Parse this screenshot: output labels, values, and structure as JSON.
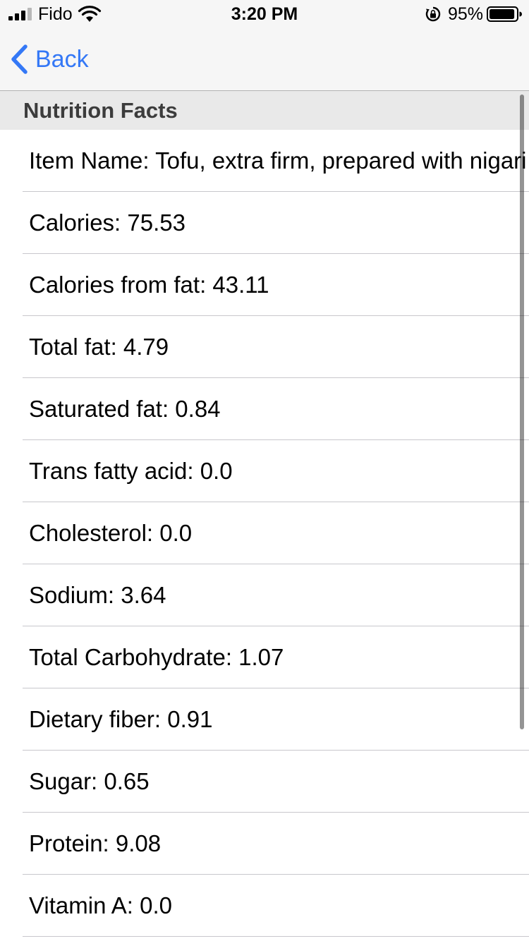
{
  "status_bar": {
    "carrier": "Fido",
    "time": "3:20 PM",
    "battery_percent": "95%",
    "battery_level": 0.95
  },
  "nav": {
    "back_label": "Back"
  },
  "section": {
    "title": "Nutrition Facts"
  },
  "rows": [
    "Item Name: Tofu, extra firm, prepared with nigari",
    "Calories: 75.53",
    "Calories from fat: 43.11",
    "Total fat: 4.79",
    "Saturated fat: 0.84",
    "Trans fatty acid: 0.0",
    "Cholesterol: 0.0",
    "Sodium: 3.64",
    "Total Carbohydrate: 1.07",
    "Dietary fiber: 0.91",
    "Sugar: 0.65",
    "Protein: 9.08",
    "Vitamin A: 0.0"
  ],
  "colors": {
    "accent": "#3478f6",
    "bar_background": "#f6f6f6",
    "section_background": "#e9e9e9",
    "separator": "#c8c7cc"
  }
}
